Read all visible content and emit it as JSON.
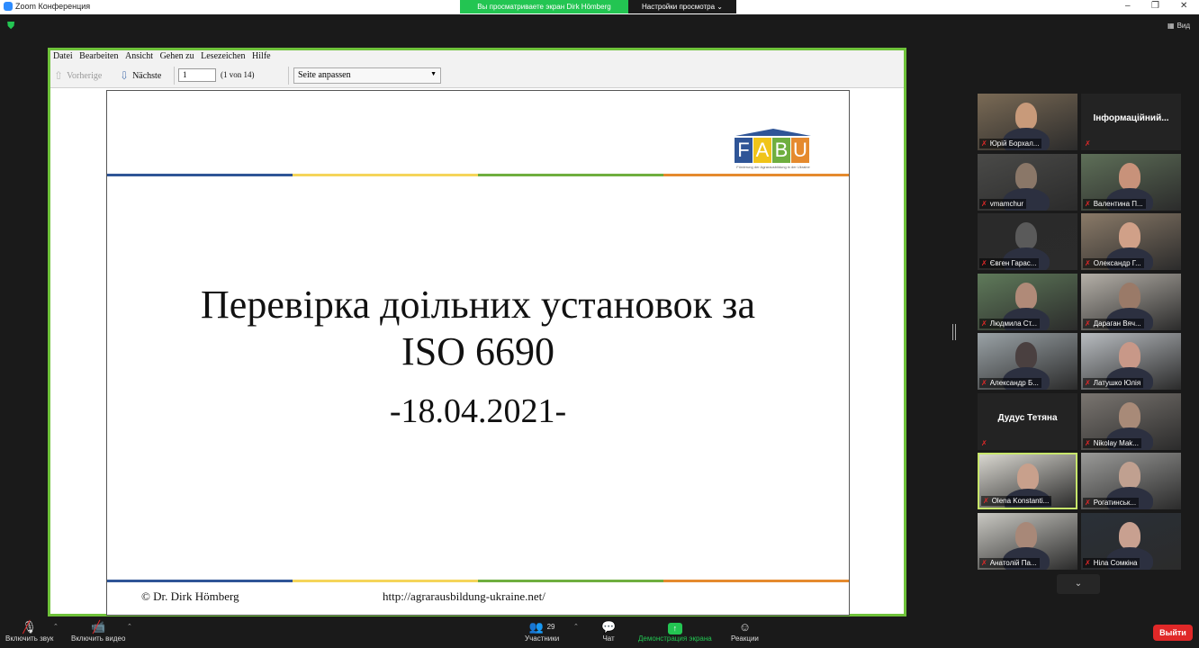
{
  "window": {
    "title": "Zoom Конференция",
    "share_banner": "Вы просматриваете экран Dirk Hömberg",
    "view_options": "Настройки просмотра",
    "view_button": "Вид",
    "controls": [
      "–",
      "❐",
      "✕"
    ]
  },
  "viewer": {
    "menu": [
      "Datei",
      "Bearbeiten",
      "Ansicht",
      "Gehen zu",
      "Lesezeichen",
      "Hilfe"
    ],
    "prev_label": "Vorherige",
    "next_label": "Nächste",
    "page_value": "1",
    "page_of": "(1 von 14)",
    "zoom_value": "Seite anpassen"
  },
  "slide": {
    "logo_letters": [
      "F",
      "A",
      "B",
      "U"
    ],
    "logo_colors": [
      "#2f5597",
      "#f0c419",
      "#6fae3f",
      "#e58a2e"
    ],
    "logo_subtitle": "Förderung der Agrarausbildung in der Ukraine",
    "stripe_colors": [
      "#2f5597",
      "#f5d55a",
      "#6fae3f",
      "#e58a2e"
    ],
    "title_line1": "Перевірка доільних установок за",
    "title_line2": "ISO 6690",
    "date": "-18.04.2021-",
    "footer_left": "© Dr. Dirk Hömberg",
    "footer_right": "http://agrarausbildung-ukraine.net/"
  },
  "participants": [
    {
      "name": "Юрій Борхал...",
      "bg": "#7a6a55",
      "skin": "#c89a7a",
      "type": "video"
    },
    {
      "name": "Інформаційний...",
      "type": "text"
    },
    {
      "name": "vmamchur",
      "bg": "#4a4a48",
      "skin": "#8a7768",
      "type": "video"
    },
    {
      "name": "Валентина П...",
      "bg": "#5e6f58",
      "skin": "#c8927a",
      "type": "video"
    },
    {
      "name": "Євген Гарас...",
      "bg": "#2a2a2a",
      "skin": "#5a5a5a",
      "type": "video"
    },
    {
      "name": "Олександр Г...",
      "bg": "#8a7a68",
      "skin": "#d0a088",
      "type": "video"
    },
    {
      "name": "Людмила Ст...",
      "bg": "#5f7a5a",
      "skin": "#b08a78",
      "type": "video"
    },
    {
      "name": "Дараган Вяч...",
      "bg": "#b5b0a8",
      "skin": "#9a7a68",
      "type": "video"
    },
    {
      "name": "Александр Б...",
      "bg": "#9aa2a6",
      "skin": "#4a4040",
      "type": "video"
    },
    {
      "name": "Латушко Юлія",
      "bg": "#b8bcc0",
      "skin": "#c89888",
      "type": "video"
    },
    {
      "name": "Дудус Тетяна",
      "type": "text"
    },
    {
      "name": "Nikolay Mak...",
      "bg": "#7a7570",
      "skin": "#a88a78",
      "type": "video"
    },
    {
      "name": "Olena Konstanti...",
      "bg": "#d8d6cf",
      "skin": "#c8a08c",
      "type": "video",
      "active": true
    },
    {
      "name": "Рогатинськ...",
      "bg": "#9a9a98",
      "skin": "#c0a090",
      "type": "video"
    },
    {
      "name": "Анатолій Па...",
      "bg": "#c9c8c2",
      "skin": "#a88878",
      "type": "video"
    },
    {
      "name": "Ніла Сомкіна",
      "bg": "#2a3038",
      "skin": "#c8a090",
      "type": "video"
    }
  ],
  "bottombar": {
    "audio": "Включить звук",
    "video": "Включить видео",
    "participants": "Участники",
    "participants_count": "29",
    "chat": "Чат",
    "share": "Демонстрация экрана",
    "reactions": "Реакции",
    "leave": "Выйти"
  }
}
